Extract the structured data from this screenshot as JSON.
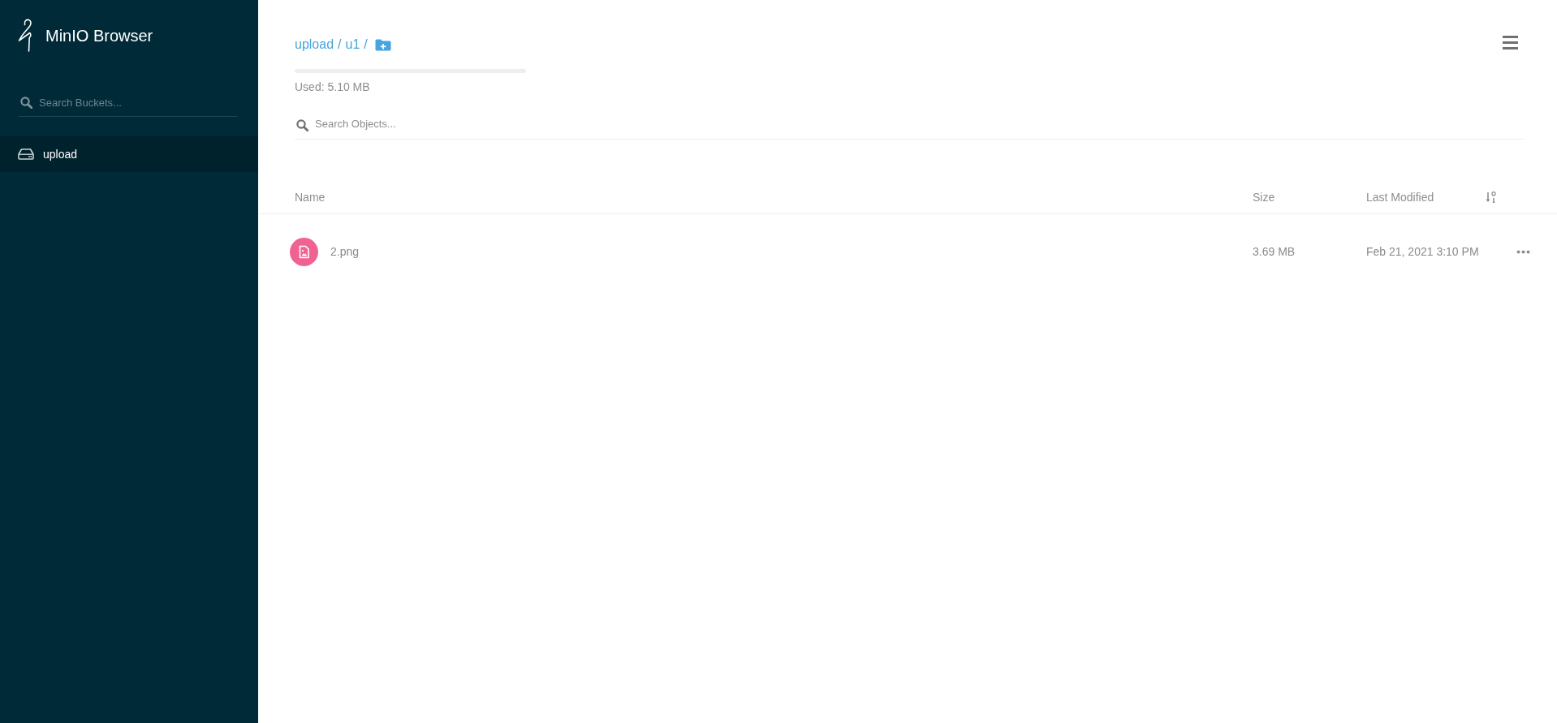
{
  "sidebar": {
    "title": "MinIO Browser",
    "search": {
      "placeholder": "Search Buckets..."
    },
    "buckets": [
      {
        "name": "upload",
        "selected": true
      }
    ]
  },
  "header": {
    "breadcrumb": [
      {
        "label": "upload",
        "separator": "/"
      },
      {
        "label": "u1",
        "separator": "/"
      }
    ],
    "usage": {
      "text": "Used: 5.10 MB"
    },
    "search": {
      "placeholder": "Search Objects..."
    }
  },
  "table": {
    "columns": [
      {
        "label": "Name",
        "sorted": false
      },
      {
        "label": "Size",
        "sorted": false
      },
      {
        "label": "Last Modified",
        "sorted": true
      }
    ],
    "rows": [
      {
        "name": "2.png",
        "size": "3.69 MB",
        "modified": "Feb 21, 2021 3:10 PM"
      }
    ]
  }
}
